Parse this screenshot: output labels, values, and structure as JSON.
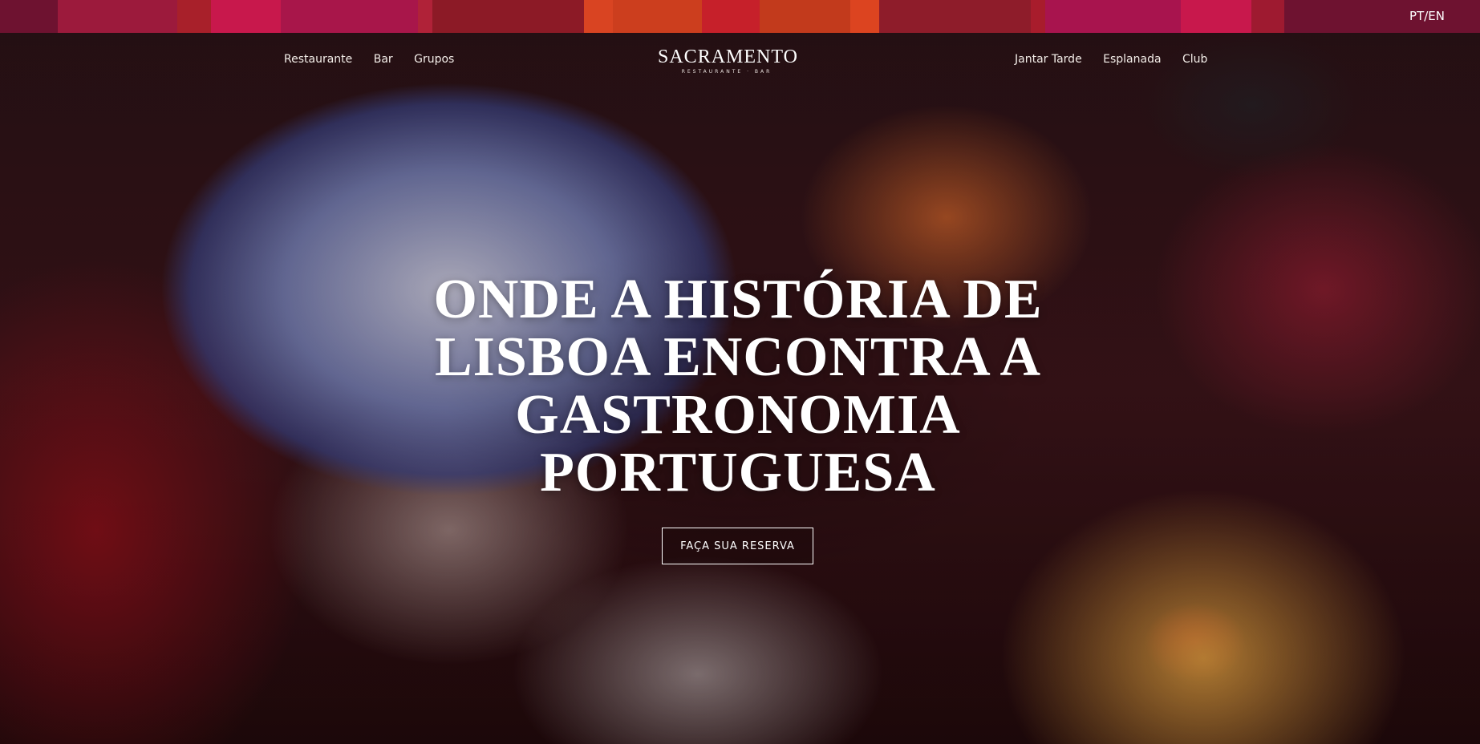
{
  "topbar": {
    "segments": [
      {
        "color": "#6e1230",
        "w": 72
      },
      {
        "color": "#9c1a3c",
        "w": 150
      },
      {
        "color": "#a8202a",
        "w": 42
      },
      {
        "color": "#c8184c",
        "w": 88
      },
      {
        "color": "#a8164a",
        "w": 172
      },
      {
        "color": "#b02238",
        "w": 18
      },
      {
        "color": "#8c1a26",
        "w": 190
      },
      {
        "color": "#d94422",
        "w": 36
      },
      {
        "color": "#cc3e1e",
        "w": 112
      },
      {
        "color": "#c6202a",
        "w": 72
      },
      {
        "color": "#c23a1c",
        "w": 114
      },
      {
        "color": "#dc4420",
        "w": 36
      },
      {
        "color": "#8e1c2a",
        "w": 190
      },
      {
        "color": "#a81c2c",
        "w": 18
      },
      {
        "color": "#a8144e",
        "w": 170
      },
      {
        "color": "#c8184c",
        "w": 88
      },
      {
        "color": "#9e1a30",
        "w": 42
      },
      {
        "color": "#6e1230",
        "w": 245
      }
    ],
    "lang": "PT/EN"
  },
  "nav": {
    "left": [
      "Restaurante",
      "Bar",
      "Grupos"
    ],
    "right": [
      "Jantar Tarde",
      "Esplanada",
      "Club"
    ]
  },
  "logo": {
    "main": "SACRAMENTO",
    "sub": "RESTAURANTE · BAR"
  },
  "hero": {
    "headline": "ONDE A HISTÓRIA DE LISBOA ENCONTRA A GASTRONOMIA PORTUGUESA",
    "cta": "FAÇA SUA RESERVA"
  }
}
